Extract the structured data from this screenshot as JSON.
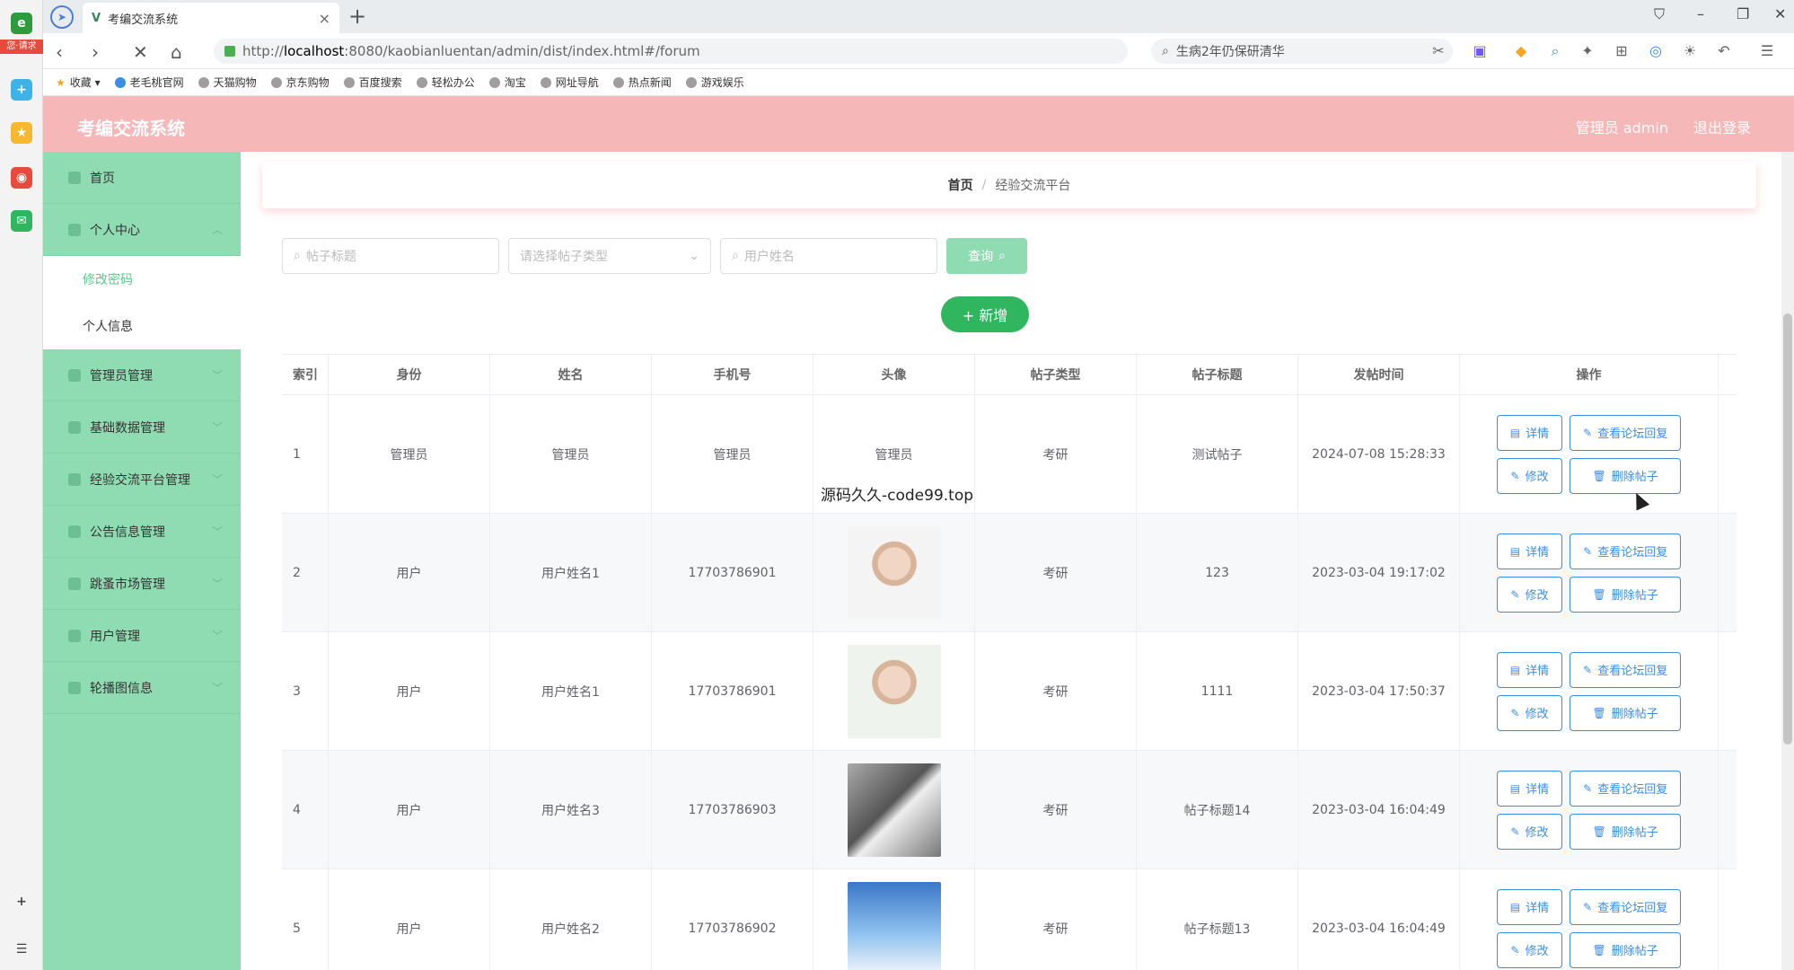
{
  "browser": {
    "tab_title": "考编交流系统",
    "url_prefix": "http://",
    "url_host": "localhost",
    "url_rest": ":8080/kaobianluentan/admin/dist/index.html#/forum",
    "search_text": "生病2年仍保研清华",
    "rail_badge": "您·请求",
    "bookmarks": [
      "收藏",
      "老毛桃官网",
      "天猫购物",
      "京东购物",
      "百度搜索",
      "轻松办公",
      "淘宝",
      "网址导航",
      "热点新闻",
      "游戏娱乐"
    ]
  },
  "header": {
    "title": "考编交流系统",
    "user": "管理员 admin",
    "logout": "退出登录"
  },
  "sidebar": {
    "home": "首页",
    "personal": "个人中心",
    "sub_password": "修改密码",
    "sub_info": "个人信息",
    "items": [
      "管理员管理",
      "基础数据管理",
      "经验交流平台管理",
      "公告信息管理",
      "跳蚤市场管理",
      "用户管理",
      "轮播图信息"
    ]
  },
  "breadcrumb": {
    "home": "首页",
    "sep": "/",
    "current": "经验交流平台"
  },
  "filters": {
    "title_placeholder": "帖子标题",
    "type_placeholder": "请选择帖子类型",
    "user_placeholder": "用户姓名",
    "query": "查询",
    "add": "+ 新增"
  },
  "table": {
    "headers": [
      "索引",
      "身份",
      "姓名",
      "手机号",
      "头像",
      "帖子类型",
      "帖子标题",
      "发帖时间",
      "操作"
    ],
    "rows": [
      {
        "idx": "1",
        "role": "管理员",
        "name": "管理员",
        "phone": "管理员",
        "avatar": "管理员",
        "type": "考研",
        "title": "测试帖子",
        "time": "2024-07-08 15:28:33"
      },
      {
        "idx": "2",
        "role": "用户",
        "name": "用户姓名1",
        "phone": "17703786901",
        "avatar": "",
        "type": "考研",
        "title": "123",
        "time": "2023-03-04 19:17:02"
      },
      {
        "idx": "3",
        "role": "用户",
        "name": "用户姓名1",
        "phone": "17703786901",
        "avatar": "",
        "type": "考研",
        "title": "1111",
        "time": "2023-03-04 17:50:37"
      },
      {
        "idx": "4",
        "role": "用户",
        "name": "用户姓名3",
        "phone": "17703786903",
        "avatar": "",
        "type": "考研",
        "title": "帖子标题14",
        "time": "2023-03-04 16:04:49"
      },
      {
        "idx": "5",
        "role": "用户",
        "name": "用户姓名2",
        "phone": "17703786902",
        "avatar": "",
        "type": "考研",
        "title": "帖子标题13",
        "time": "2023-03-04 16:04:49"
      }
    ],
    "op_detail": "详情",
    "op_reply": "查看论坛回复",
    "op_edit": "修改",
    "op_delete": "删除帖子"
  },
  "overlay_text": "源码久久-code99.top",
  "colors": {
    "header_bg": "#f6b7b9",
    "sidebar_bg": "#8fdcb3",
    "add_button": "#2fb65e",
    "op_button": "#3a8ee6"
  }
}
